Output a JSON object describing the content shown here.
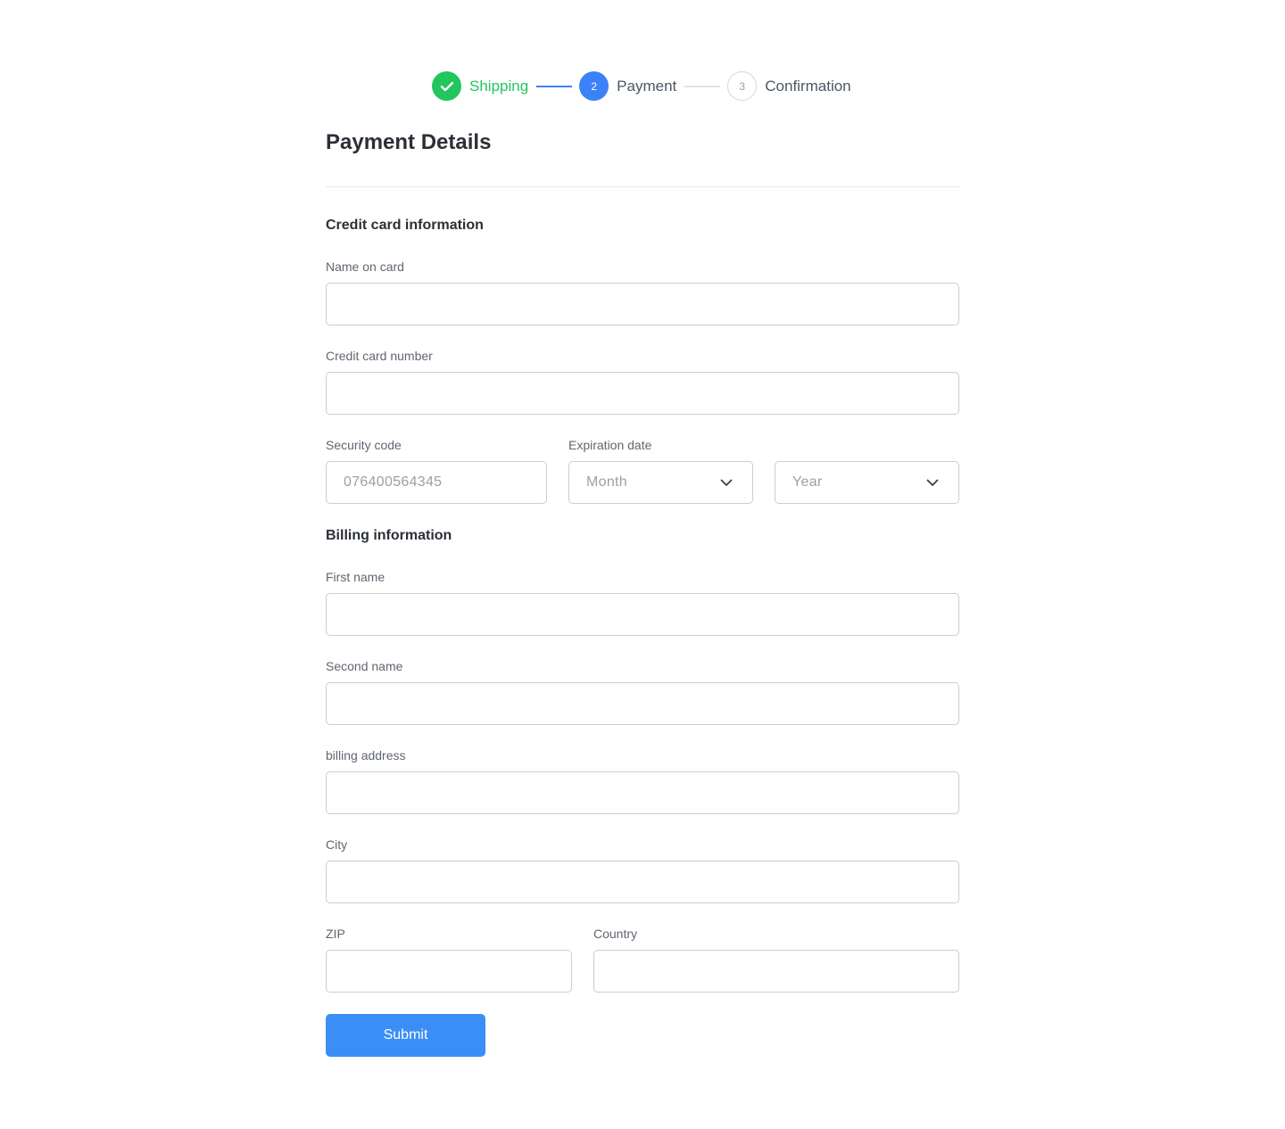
{
  "stepper": {
    "steps": [
      {
        "label": "Shipping",
        "state": "done",
        "number": ""
      },
      {
        "label": "Payment",
        "state": "active",
        "number": "2"
      },
      {
        "label": "Confirmation",
        "state": "pending",
        "number": "3"
      }
    ],
    "colors": {
      "done": "#22c55e",
      "active": "#3b82f6",
      "pending": "#d4d7dc"
    }
  },
  "page_title": "Payment Details",
  "credit_section": {
    "title": "Credit card information",
    "name_on_card_label": "Name on card",
    "name_on_card_value": "",
    "card_number_label": "Credit card number",
    "card_number_value": "",
    "security_code_label": "Security code",
    "security_code_value": "076400564345",
    "expiration_label": "Expiration date",
    "month_value": "Month",
    "year_value": "Year"
  },
  "billing_section": {
    "title": "Billing information",
    "first_name_label": "First name",
    "second_name_label": "Second name",
    "address_label": "billing address",
    "city_label": "City",
    "zip_label": "ZIP",
    "country_label": "Country"
  },
  "submit_label": "Submit",
  "icons": {
    "check": "check-icon",
    "chevron": "chevron-down-icon"
  },
  "accent_color": "#3b8ef5"
}
